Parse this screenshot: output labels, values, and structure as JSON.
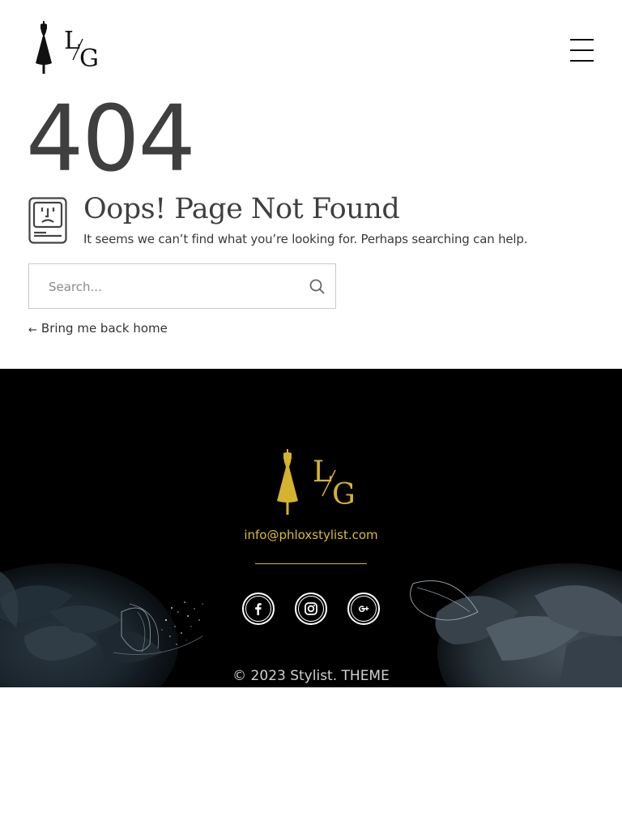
{
  "header": {
    "logo_letters": {
      "top": "L",
      "bottom": "G"
    },
    "menu_icon": "hamburger-menu-icon"
  },
  "error": {
    "code": "404",
    "icon": "sad-computer-icon",
    "title": "Oops! Page Not Found",
    "message": "It seems we can’t find what you’re looking for. Perhaps searching can help.",
    "search_placeholder": "Search...",
    "search_icon": "search-icon",
    "back_arrow": "←",
    "back_label": "Bring me back home"
  },
  "footer": {
    "email": "info@phloxstylist.com",
    "social": [
      {
        "name": "facebook",
        "icon": "facebook-icon"
      },
      {
        "name": "instagram",
        "icon": "instagram-icon"
      },
      {
        "name": "google-plus",
        "icon": "google-plus-icon"
      }
    ],
    "copyright": "© 2023 Stylist. THEME"
  },
  "colors": {
    "text_dark": "#3f3f3f",
    "accent_gold": "#d4b32f",
    "footer_bg": "#000000",
    "flower_tone": "#3a4a55"
  }
}
